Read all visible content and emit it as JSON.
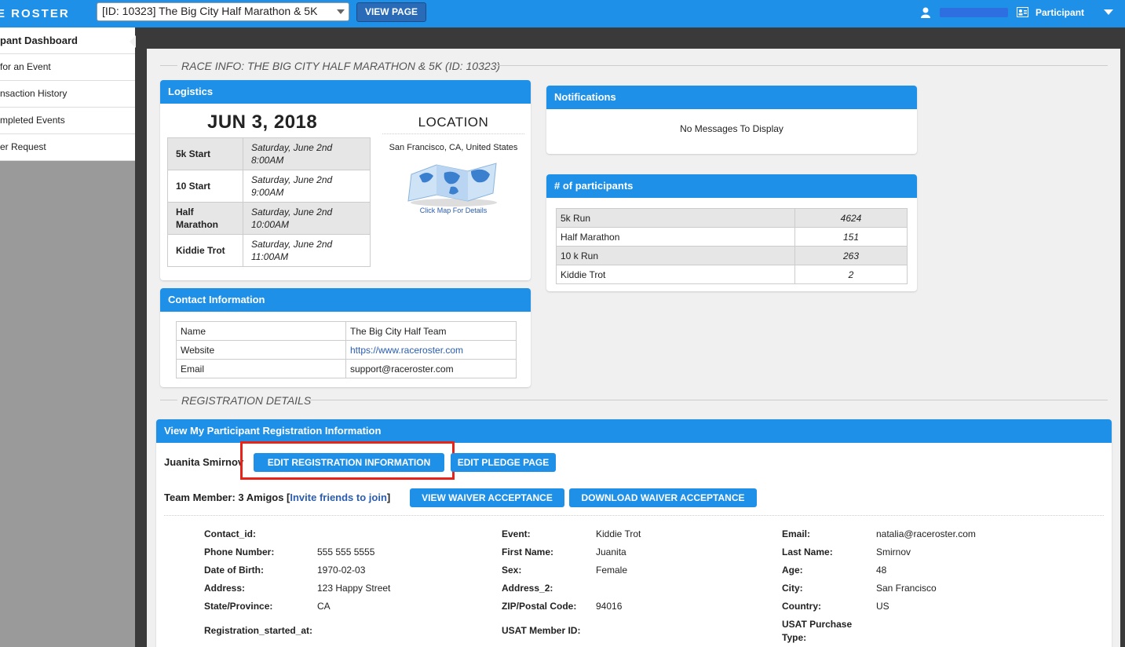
{
  "topbar": {
    "brand": "E ROSTER",
    "event_select": "[ID: 10323] The Big City Half Marathon & 5K",
    "view_page": "VIEW PAGE",
    "participant": "Participant"
  },
  "sidebar": {
    "items": [
      {
        "label": "pant Dashboard"
      },
      {
        "label": " for an Event"
      },
      {
        "label": "nsaction History"
      },
      {
        "label": "mpleted Events"
      },
      {
        "label": "er Request"
      }
    ]
  },
  "race_info": {
    "title": "RACE INFO: THE BIG CITY HALF MARATHON & 5K (ID: 10323)"
  },
  "logistics": {
    "heading": "Logistics",
    "date": "JUN 3, 2018",
    "rows": [
      {
        "name": "5k Start",
        "time1": "Saturday, June 2nd",
        "time2": "8:00AM"
      },
      {
        "name": "10 Start",
        "time1": "Saturday, June 2nd",
        "time2": "9:00AM"
      },
      {
        "name": "Half Marathon",
        "time1": "Saturday, June 2nd",
        "time2": "10:00AM"
      },
      {
        "name": "Kiddie Trot",
        "time1": "Saturday, June 2nd",
        "time2": "11:00AM"
      }
    ],
    "location_title": "LOCATION",
    "location": "San Francisco, CA, United States",
    "map_link": "Click Map For Details"
  },
  "contact": {
    "heading": "Contact Information",
    "rows": [
      {
        "label": "Name",
        "value": "The Big City Half Team"
      },
      {
        "label": "Website",
        "value": "https://www.raceroster.com"
      },
      {
        "label": "Email",
        "value": "support@raceroster.com"
      }
    ]
  },
  "notifications": {
    "heading": "Notifications",
    "message": "No Messages To Display"
  },
  "participants": {
    "heading": "# of participants",
    "rows": [
      {
        "event": "5k Run",
        "count": "4624"
      },
      {
        "event": "Half Marathon",
        "count": "151"
      },
      {
        "event": "10 k Run",
        "count": "263"
      },
      {
        "event": "Kiddie Trot",
        "count": "2"
      }
    ]
  },
  "registration": {
    "section_title": "REGISTRATION DETAILS",
    "heading": "View My Participant Registration Information",
    "name": "Juanita Smirnov",
    "edit_reg": "EDIT REGISTRATION INFORMATION",
    "edit_pledge": "EDIT PLEDGE PAGE",
    "team_prefix": "Team Member: 3 Amigos [",
    "invite": "Invite friends to join",
    "team_suffix": "]",
    "view_waiver": "VIEW WAIVER ACCEPTANCE",
    "download_waiver": "DOWNLOAD WAIVER ACCEPTANCE",
    "fields": {
      "contact_id": {
        "label": "Contact_id:",
        "value": ""
      },
      "phone": {
        "label": "Phone Number:",
        "value": "555 555 5555"
      },
      "dob": {
        "label": "Date of Birth:",
        "value": "1970-02-03"
      },
      "address": {
        "label": "Address:",
        "value": "123 Happy Street"
      },
      "state": {
        "label": "State/Province:",
        "value": "CA"
      },
      "reg_started": {
        "label": "Registration_started_at:",
        "value": ""
      },
      "event": {
        "label": "Event:",
        "value": "Kiddie Trot"
      },
      "first_name": {
        "label": "First Name:",
        "value": "Juanita"
      },
      "sex": {
        "label": "Sex:",
        "value": "Female"
      },
      "address2": {
        "label": "Address_2:",
        "value": ""
      },
      "zip": {
        "label": "ZIP/Postal Code:",
        "value": "94016"
      },
      "usat_id": {
        "label": "USAT Member ID:",
        "value": ""
      },
      "email": {
        "label": "Email:",
        "value": "natalia@raceroster.com"
      },
      "last_name": {
        "label": "Last Name:",
        "value": "Smirnov"
      },
      "age": {
        "label": "Age:",
        "value": "48"
      },
      "city": {
        "label": "City:",
        "value": "San Francisco"
      },
      "country": {
        "label": "Country:",
        "value": "US"
      },
      "usat_type_1": {
        "label": "USAT Purchase",
        "value": ""
      },
      "usat_type_2": {
        "label": "Type:",
        "value": ""
      }
    }
  },
  "colors": {
    "accent": "#1e90e8",
    "highlight": "#e8231a"
  }
}
